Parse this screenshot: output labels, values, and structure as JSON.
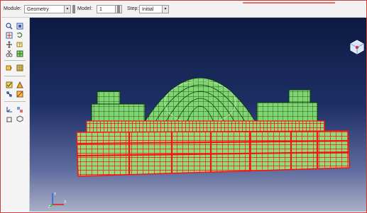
{
  "toolbar": {
    "module_label": "Module:",
    "module_value": "Geometry",
    "model_label": "Model:",
    "model_value": "1",
    "step_label": "Step:",
    "step_value": "Initial"
  },
  "sidebar": {
    "tools": [
      "zoom-icon",
      "box-zoom-icon",
      "fit-view-icon",
      "rotate-icon",
      "pan-icon",
      "query-icon",
      "cut-icon",
      "mesh-seed-icon",
      "assign-mesh-icon",
      "mesh-part-icon",
      "verify-mesh-icon",
      "element-type-icon",
      "node-edit-icon",
      "partition-icon",
      "triad-icon",
      "display-group-icon"
    ]
  },
  "colors": {
    "mesh_fill": "#7ed36f",
    "mesh_line_red": "#ff1010",
    "mesh_line_dark": "#0a3a0a",
    "viewport_top": "#0c1a40",
    "viewport_bottom": "#aab0c8",
    "frame_border": "#d23a3a"
  },
  "triad": {
    "x_label": "X",
    "y_label": "Y",
    "z_label": "Z"
  }
}
